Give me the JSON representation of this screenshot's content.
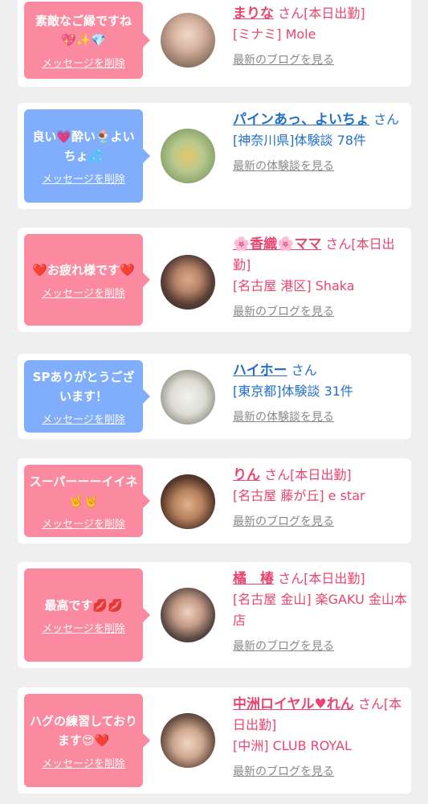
{
  "cards": [
    {
      "message": "素敵なご縁ですね💖✨💎",
      "delete": "メッセージを削除",
      "name": "まりな",
      "suffix": " さん[本日出勤]",
      "detail": "[ミナミ] Mole",
      "link": "最新のブログを見る"
    },
    {
      "message": "良い💗酔い🍨よいちょ💦",
      "delete": "メッセージを削除",
      "name": "パインあっ、よいちょ",
      "suffix": " さん",
      "detail": "[神奈川県]体験談 78件",
      "link": "最新の体験談を見る"
    },
    {
      "message": "❤️お疲れ様です❤️",
      "delete": "メッセージを削除",
      "name": "🌸香織🌸ママ",
      "suffix": " さん[本日出勤]",
      "detail": "[名古屋 港区] Shaka",
      "link": "最新のブログを見る"
    },
    {
      "message": "SPありがとうございます！",
      "delete": "メッセージを削除",
      "name": "ハイホー",
      "suffix": " さん",
      "detail": "[東京都]体験談 31件",
      "link": "最新の体験談を見る"
    },
    {
      "message": "スーパーーーイイネ🤘🤘",
      "delete": "メッセージを削除",
      "name": "りん",
      "suffix": " さん[本日出勤]",
      "detail": "[名古屋 藤が丘] e star",
      "link": "最新のブログを見る"
    },
    {
      "message": "最高です💋💋",
      "delete": "メッセージを削除",
      "name": "橘　椿",
      "suffix": " さん[本日出勤]",
      "detail": "[名古屋 金山] 楽GAKU 金山本店",
      "link": "最新のブログを見る"
    },
    {
      "message": "ハグの練習しております😍❤️",
      "delete": "メッセージを削除",
      "name": "中洲ロイヤル♥れん",
      "suffix": " さん[本日出勤]",
      "detail": "[中洲] CLUB ROYAL",
      "link": "最新のブログを見る"
    }
  ],
  "colors": {
    "pink": "#fb8aa0",
    "blue": "#80aefd",
    "pinkText": "#e8456f",
    "blueText": "#2470c8"
  }
}
